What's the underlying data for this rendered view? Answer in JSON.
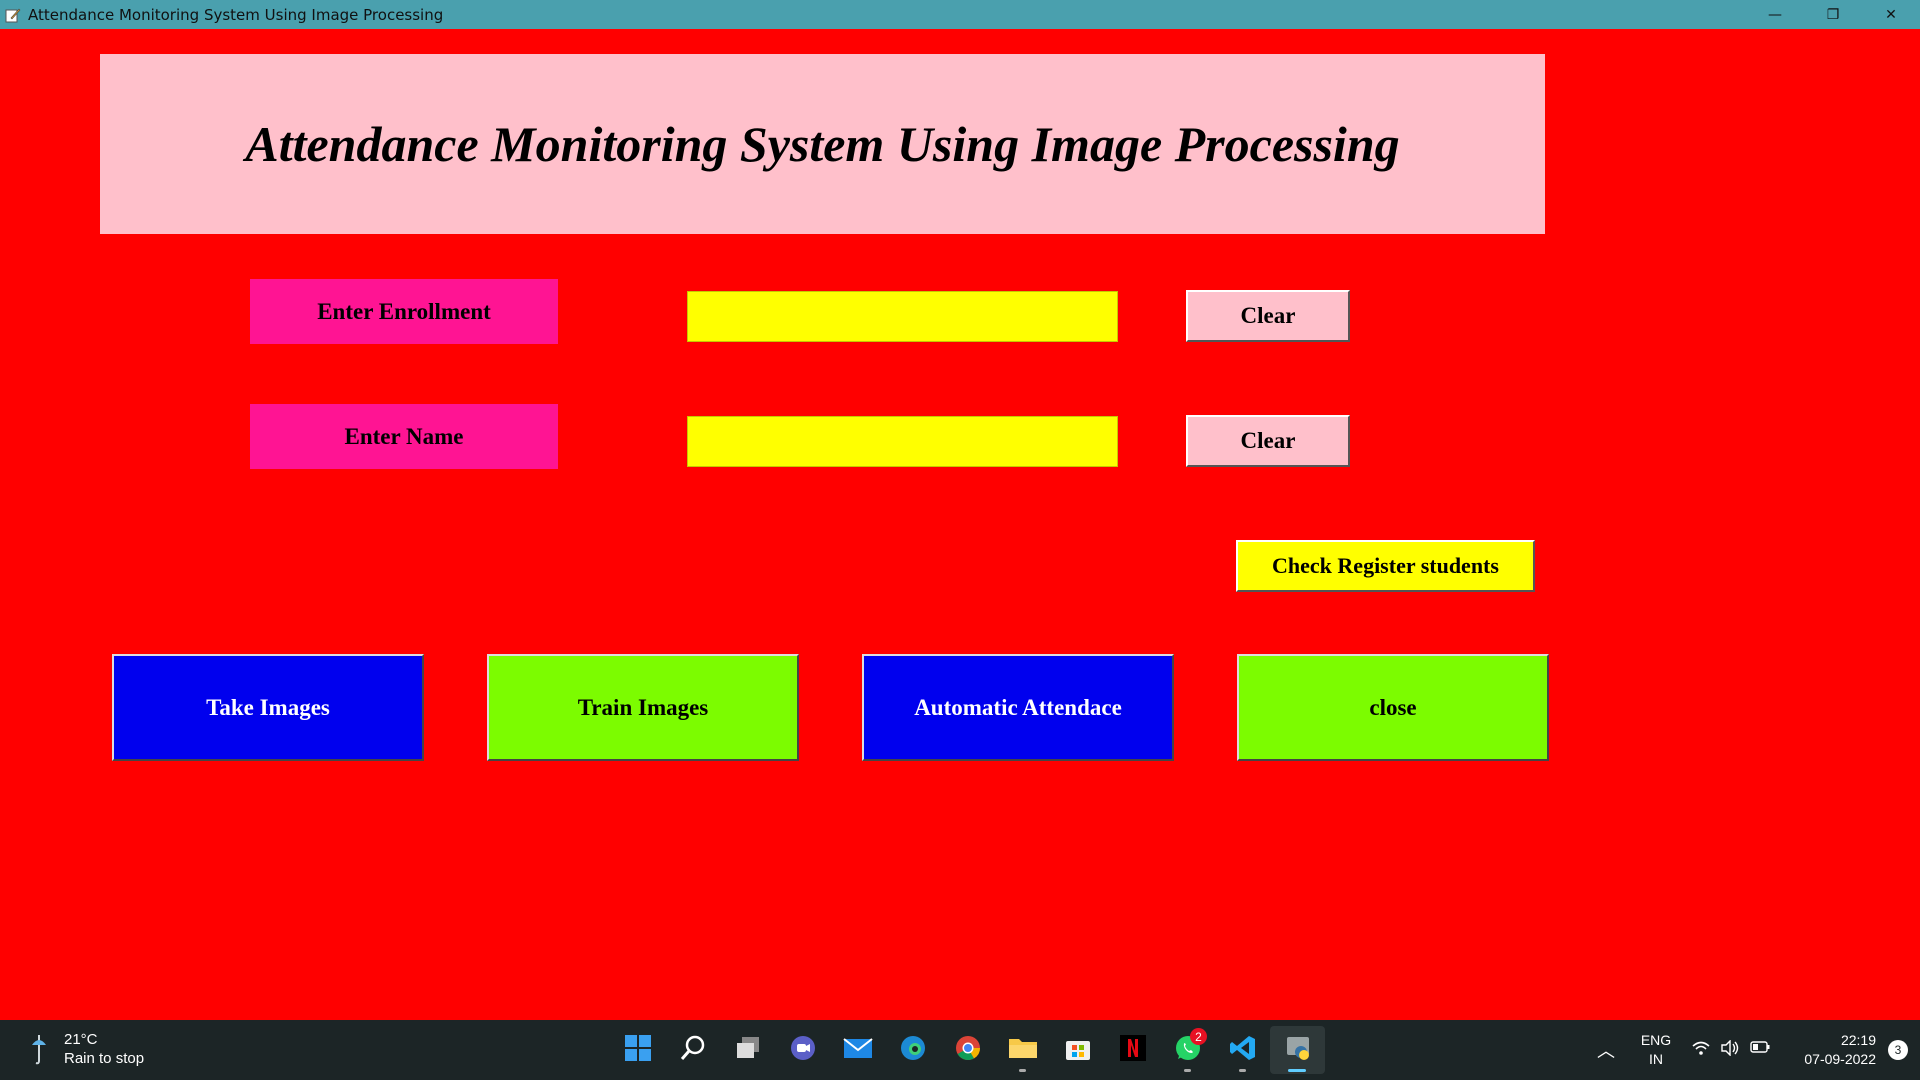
{
  "window": {
    "title": "Attendance Monitoring System Using Image Processing",
    "controls": {
      "minimize": "—",
      "restore": "❐",
      "close": "✕"
    }
  },
  "header": {
    "title": "Attendance Monitoring System Using Image Processing"
  },
  "form": {
    "enrollment_label": "Enter Enrollment",
    "enrollment_value": "",
    "name_label": "Enter Name",
    "name_value": "",
    "clear_enrollment": "Clear",
    "clear_name": "Clear",
    "check_register": "Check Register students"
  },
  "actions": {
    "take_images": "Take Images",
    "train_images": "Train Images",
    "automatic_attendance": "Automatic Attendace",
    "close": "close"
  },
  "colors": {
    "background": "#ff0000",
    "header_bg": "#ffc0cb",
    "label_bg": "#ff1493",
    "input_bg": "#ffff00",
    "blue_btn": "#0000ee",
    "green_btn": "#7cfc00"
  },
  "taskbar": {
    "weather_temp": "21°C",
    "weather_desc": "Rain to stop",
    "apps": [
      "windows-start",
      "search",
      "task-view",
      "teams-chat",
      "mail",
      "edge",
      "chrome",
      "file-explorer",
      "microsoft-store",
      "netflix",
      "whatsapp",
      "vscode",
      "python"
    ],
    "whatsapp_badge": "2",
    "lang_line1": "ENG",
    "lang_line2": "IN",
    "time": "22:19",
    "date": "07-09-2022",
    "notification_count": "3"
  }
}
